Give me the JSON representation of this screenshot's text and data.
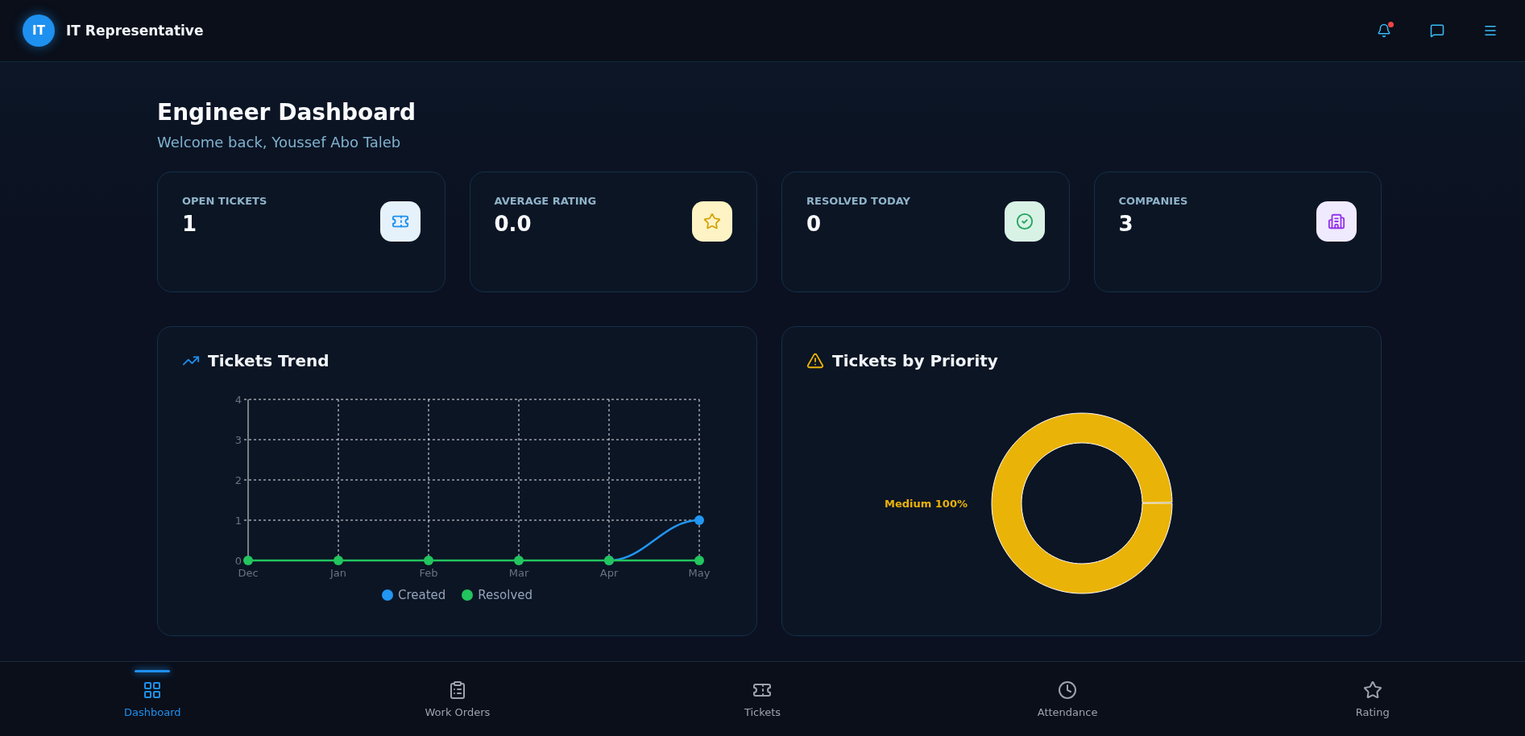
{
  "header": {
    "avatar": "IT",
    "title": "IT Representative",
    "notifications_unread": true
  },
  "page": {
    "title": "Engineer Dashboard",
    "subtitle": "Welcome back, Youssef Abo Taleb"
  },
  "stats": [
    {
      "label": "OPEN TICKETS",
      "value": "1",
      "kind": "ticket"
    },
    {
      "label": "AVERAGE RATING",
      "value": "0.0",
      "kind": "star"
    },
    {
      "label": "RESOLVED TODAY",
      "value": "0",
      "kind": "check"
    },
    {
      "label": "COMPANIES",
      "value": "3",
      "kind": "building"
    }
  ],
  "trend": {
    "title": "Tickets Trend",
    "chart_data": {
      "type": "line",
      "grid": true,
      "categories": [
        "Dec",
        "Jan",
        "Feb",
        "Mar",
        "Apr",
        "May"
      ],
      "ylim": [
        0,
        4
      ],
      "yticks": [
        0,
        1,
        2,
        3,
        4
      ],
      "series": [
        {
          "name": "Created",
          "color": "#2196f3",
          "marker": true,
          "values": [
            null,
            null,
            null,
            null,
            0,
            1
          ]
        },
        {
          "name": "Resolved",
          "color": "#22c55e",
          "marker": true,
          "values": [
            0,
            0,
            0,
            0,
            0,
            0
          ]
        }
      ]
    }
  },
  "priority": {
    "title": "Tickets by Priority",
    "chart_data": {
      "type": "donut",
      "categories": [
        "Medium"
      ],
      "value_labels": [
        "100%"
      ],
      "series": [
        {
          "color": "#eab308",
          "values": [
            100
          ]
        }
      ]
    }
  },
  "nav": [
    {
      "label": "Dashboard",
      "kind": "dashboard",
      "selected": true
    },
    {
      "label": "Work Orders",
      "kind": "clipboard",
      "selected": false
    },
    {
      "label": "Tickets",
      "kind": "ticket",
      "selected": false
    },
    {
      "label": "Attendance",
      "kind": "clock",
      "selected": false
    },
    {
      "label": "Rating",
      "kind": "star",
      "selected": false
    }
  ]
}
